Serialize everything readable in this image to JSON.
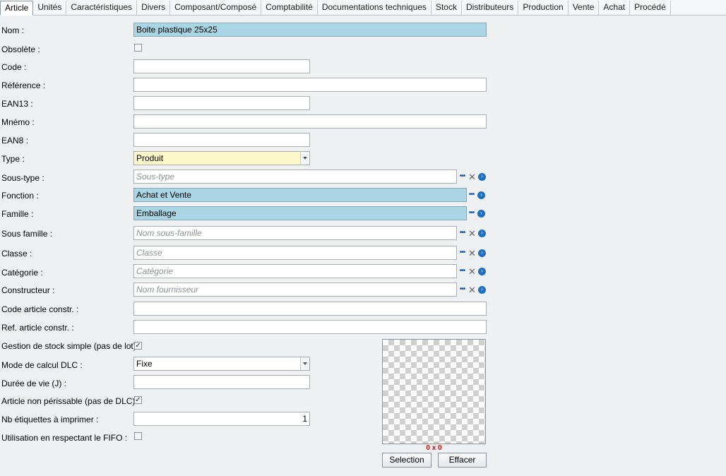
{
  "tabs": [
    "Article",
    "Unités",
    "Caractéristiques",
    "Divers",
    "Composant/Composé",
    "Comptabilité",
    "Documentations techniques",
    "Stock",
    "Distributeurs",
    "Production",
    "Vente",
    "Achat",
    "Procédé"
  ],
  "labels": {
    "nom": "Nom :",
    "obsolete": "Obsolète :",
    "code": "Code :",
    "reference": "Référence :",
    "ean13": "EAN13 :",
    "mnemo": "Mnémo :",
    "ean8": "EAN8 :",
    "type": "Type :",
    "sous_type": "Sous-type :",
    "fonction": "Fonction :",
    "famille": "Famille :",
    "sous_famille": "Sous famille :",
    "classe": "Classe :",
    "categorie": "Catégorie :",
    "constructeur": "Constructeur :",
    "code_article_constr": "Code article constr. :",
    "ref_article_constr": "Ref. article constr. :",
    "gestion_stock": "Gestion de stock simple (pas de lot) :",
    "mode_dlc": "Mode de calcul DLC :",
    "duree_vie": "Durée de vie (J) :",
    "non_perissable": "Article non périssable (pas de DLC) :",
    "nb_etiquettes": "Nb étiquettes à imprimer :",
    "fifo": "Utilisation en respectant le FIFO :"
  },
  "values": {
    "nom": "Boite plastique 25x25",
    "code": "",
    "reference": "",
    "ean13": "",
    "mnemo": "",
    "ean8": "",
    "type": "Produit",
    "fonction": "Achat et Vente",
    "famille": "Emballage",
    "code_article_constr": "",
    "ref_article_constr": "",
    "mode_dlc": "Fixe",
    "duree_vie": "",
    "nb_etiquettes": "1"
  },
  "placeholders": {
    "sous_type": "Sous-type",
    "sous_famille": "Nom sous-famille",
    "classe": "Classe",
    "categorie": "Catégorie",
    "constructeur": "Nom fournisseur"
  },
  "checkboxes": {
    "obsolete": false,
    "gestion_stock": true,
    "non_perissable": true,
    "fifo": false
  },
  "image": {
    "dimensions": "0 x 0"
  },
  "buttons": {
    "selection": "Selection",
    "effacer": "Effacer"
  },
  "colors": {
    "required_field": "#aad5e4",
    "type_field": "#fdf8c8",
    "dimension_text": "#e00000"
  }
}
